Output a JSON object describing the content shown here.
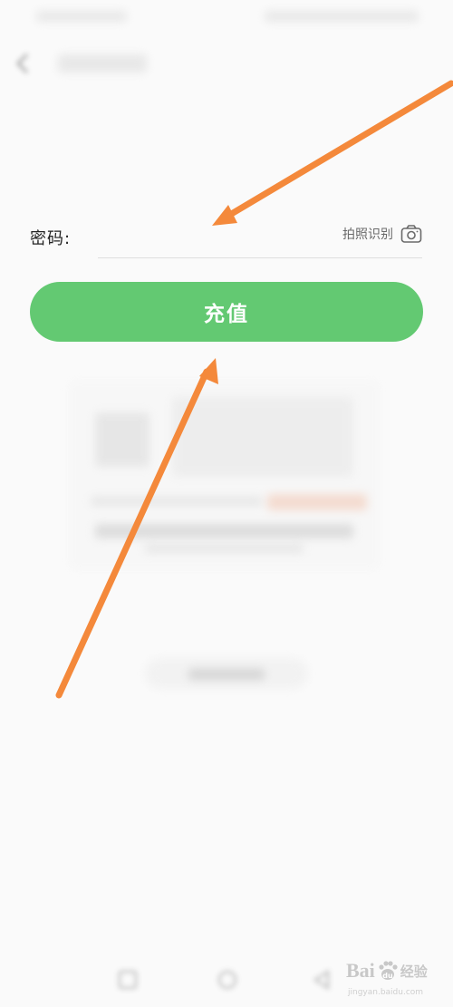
{
  "form": {
    "password_label": "密码:",
    "password_value": "",
    "scan_label": "拍照识别",
    "recharge_label": "充值"
  },
  "icons": [
    "back-icon",
    "camera-icon",
    "nav-recent-icon",
    "nav-home-icon",
    "nav-back-icon",
    "baidu-paw-icon"
  ],
  "colors": {
    "primary_button": "#63c972",
    "annotation_arrow": "#f4893b",
    "background": "#fafafa"
  },
  "watermark": {
    "brand": "Bai",
    "brand_suffix": "经验",
    "url": "jingyan.baidu.com"
  }
}
